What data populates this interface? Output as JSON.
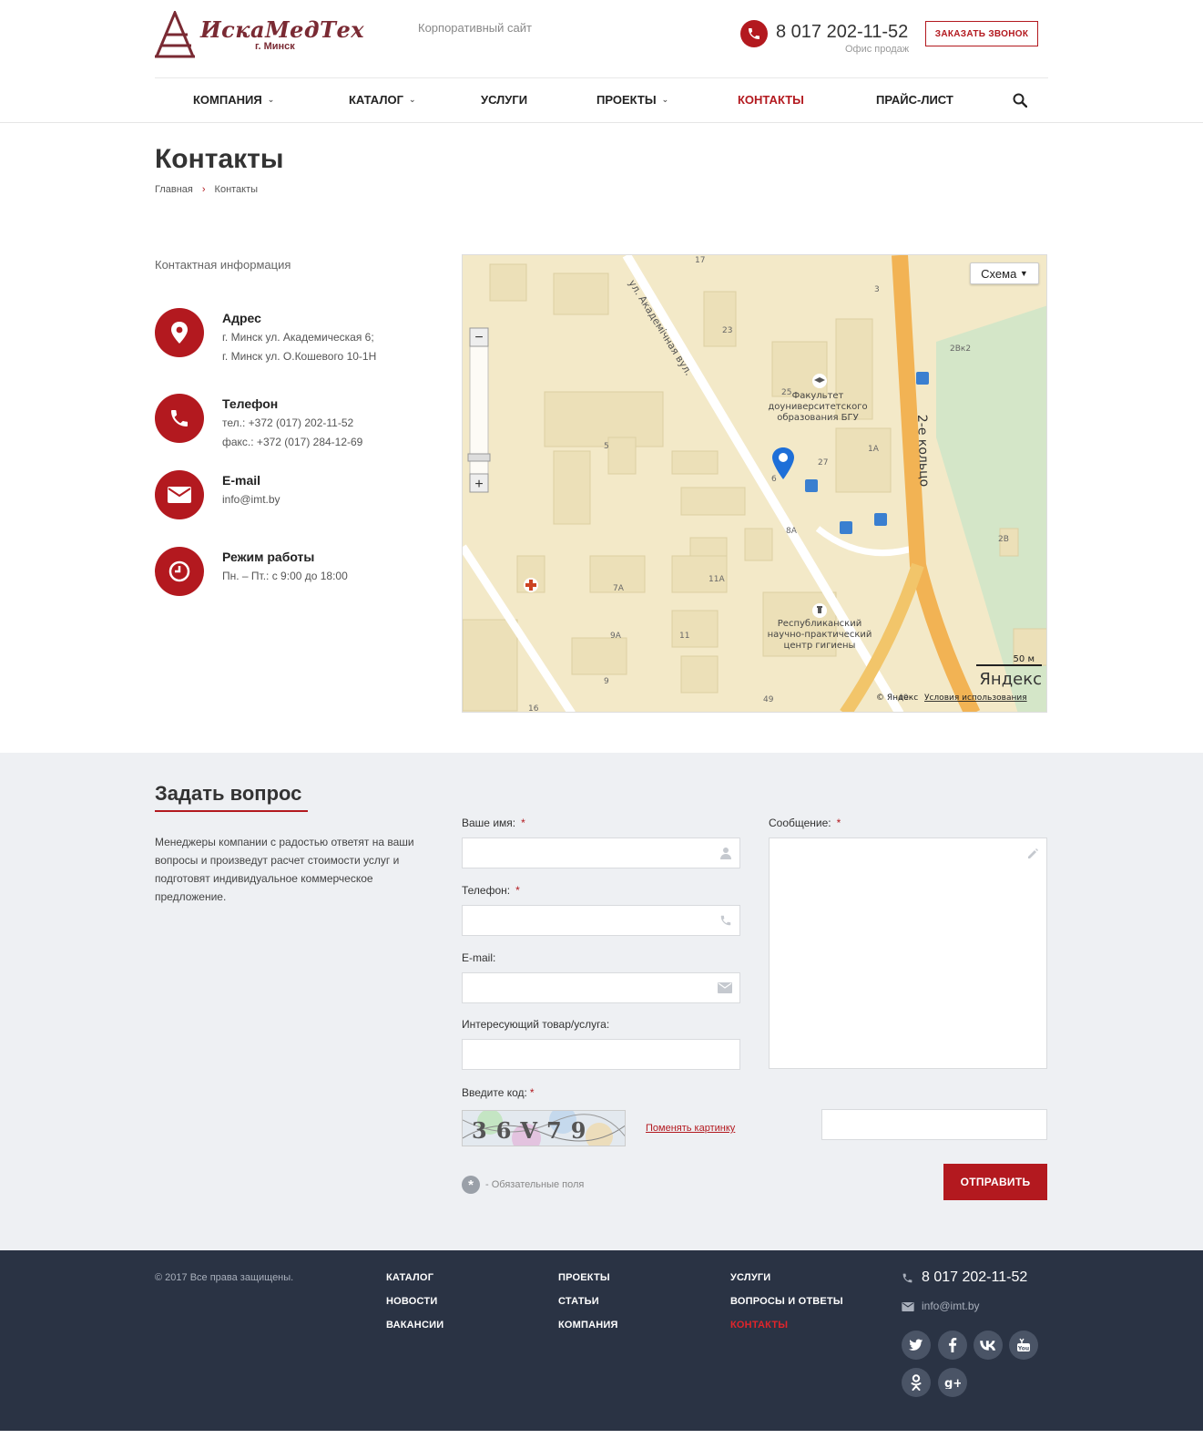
{
  "header": {
    "logo_name": "ИскаМедТех",
    "logo_city": "г. Минск",
    "tagline": "Корпоративный сайт",
    "phone": "8 017 202-11-52",
    "phone_note": "Офис продаж",
    "callback_label": "ЗАКАЗАТЬ ЗВОНОК"
  },
  "nav": {
    "items": [
      {
        "label": "КОМПАНИЯ",
        "dropdown": true
      },
      {
        "label": "КАТАЛОГ",
        "dropdown": true
      },
      {
        "label": "УСЛУГИ",
        "dropdown": false
      },
      {
        "label": "ПРОЕКТЫ",
        "dropdown": true
      },
      {
        "label": "КОНТАКТЫ",
        "dropdown": false,
        "active": true
      },
      {
        "label": "ПРАЙС-ЛИСТ",
        "dropdown": false
      }
    ],
    "search_icon": "search-icon"
  },
  "page": {
    "title": "Контакты",
    "breadcrumb": [
      "Главная",
      "Контакты"
    ]
  },
  "contacts": {
    "section_label": "Контактная информация",
    "address": {
      "title": "Адрес",
      "lines": [
        "г. Минск ул. Академическая 6;",
        "г. Минск ул. О.Кошевого 10-1Н"
      ]
    },
    "phone": {
      "title": "Телефон",
      "lines": [
        "тел.: +372 (017) 202-11-52",
        "факс.: +372 (017) 284-12-69"
      ]
    },
    "email": {
      "title": "E-mail",
      "lines": [
        "info@imt.by"
      ]
    },
    "hours": {
      "title": "Режим работы",
      "lines": [
        "Пн. – Пт.: с 9:00 до 18:00"
      ]
    }
  },
  "map": {
    "type_label": "Схема",
    "street": "ул. Академічная вул.",
    "ring_road": "2-е кольцо",
    "poi_1": [
      "Факультет",
      "доуниверситетского",
      "образования БГУ"
    ],
    "poi_2": [
      "Республиканский",
      "научно-практический",
      "центр гигиены"
    ],
    "scale": "50 м",
    "brand": "Яндекс",
    "copyright": "© Яндекс",
    "terms": "Условия использования",
    "house_numbers": [
      "17",
      "3",
      "23",
      "2Вк2",
      "25",
      "1А",
      "5",
      "27",
      "6",
      "8А",
      "2В",
      "11А",
      "7А",
      "9А",
      "11",
      "9",
      "49",
      "16",
      "40"
    ]
  },
  "question": {
    "title": "Задать вопрос",
    "description": "Менеджеры компании с радостью ответят на ваши вопросы и произведут расчет стоимости услуг и подготовят индивидуальное коммерческое предложение.",
    "fields": {
      "name": {
        "label": "Ваше имя:",
        "required": true,
        "value": "",
        "icon": "user-icon"
      },
      "phone": {
        "label": "Телефон:",
        "required": true,
        "value": "",
        "icon": "phone-icon"
      },
      "email": {
        "label": "E-mail:",
        "required": false,
        "value": "",
        "icon": "envelope-icon"
      },
      "product": {
        "label": "Интересующий товар/услуга:",
        "required": false,
        "value": ""
      },
      "message": {
        "label": "Сообщение:",
        "required": true,
        "value": "",
        "icon": "pencil-icon"
      },
      "code": {
        "label": "Введите код:",
        "required": true,
        "value": ""
      }
    },
    "required_star": "*",
    "captcha_text": "36V79",
    "change_picture": "Поменять картинку",
    "required_note": "- Обязательные поля",
    "submit_label": "ОТПРАВИТЬ"
  },
  "footer": {
    "copyright": "© 2017 Все права защищены.",
    "columns": [
      [
        "КАТАЛОГ",
        "НОВОСТИ",
        "ВАКАНСИИ"
      ],
      [
        "ПРОЕКТЫ",
        "СТАТЬИ",
        "КОМПАНИЯ"
      ],
      [
        "УСЛУГИ",
        "ВОПРОСЫ И ОТВЕТЫ",
        "КОНТАКТЫ"
      ]
    ],
    "phone": "8 017 202-11-52",
    "email": "info@imt.by",
    "social": [
      "twitter-icon",
      "facebook-icon",
      "vk-icon",
      "youtube-icon",
      "odnoklassniki-icon",
      "google-plus-icon"
    ]
  },
  "colors": {
    "accent": "#b3191f",
    "footer_bg": "#2a3344",
    "section_bg": "#eef0f3"
  }
}
